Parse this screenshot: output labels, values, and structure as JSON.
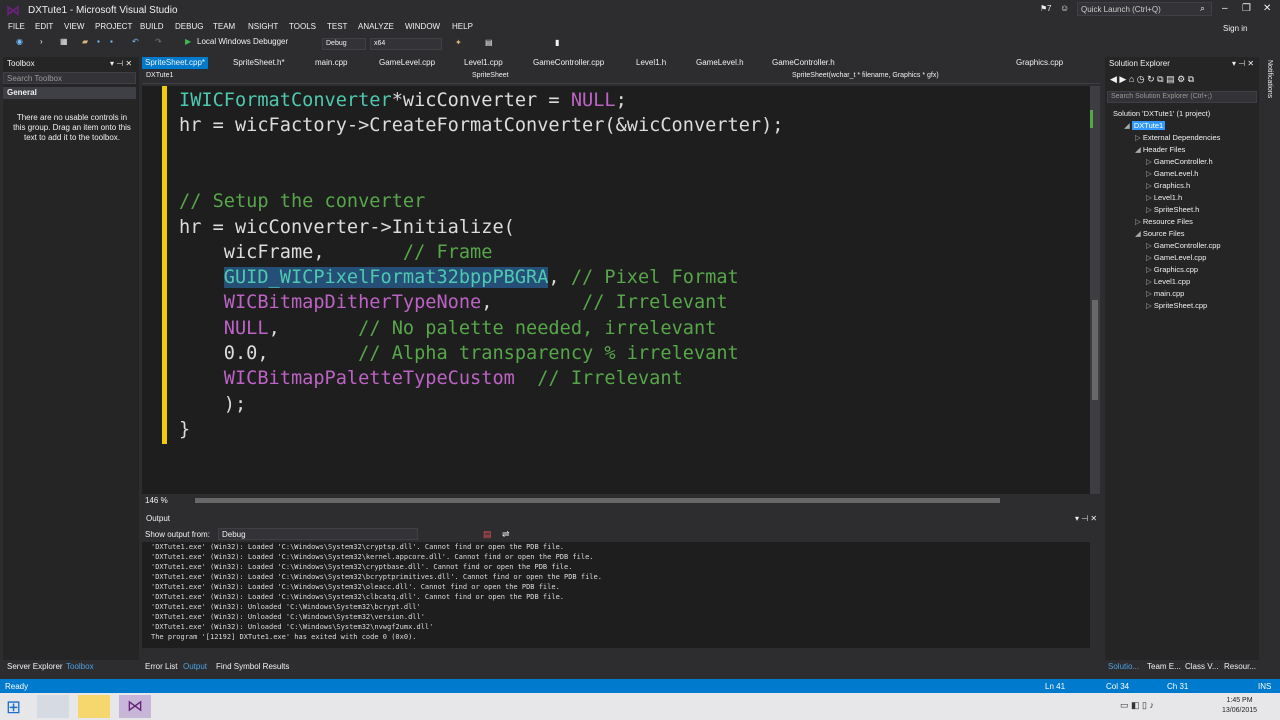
{
  "window": {
    "title": "DXTute1 - Microsoft Visual Studio"
  },
  "menu": [
    "FILE",
    "EDIT",
    "VIEW",
    "PROJECT",
    "BUILD",
    "DEBUG",
    "TEAM",
    "NSIGHT",
    "TOOLS",
    "TEST",
    "ANALYZE",
    "WINDOW",
    "HELP"
  ],
  "toolbar": {
    "debugger": "Local Windows Debugger",
    "config": "Debug",
    "platform": "x64",
    "quick_launch": "Quick Launch (Ctrl+Q)",
    "notifications": "7",
    "sign_in": "Sign in"
  },
  "toolbox": {
    "title": "Toolbox",
    "search": "Search Toolbox",
    "group": "General",
    "note": "There are no usable controls in this group. Drag an item onto this text to add it to the toolbox."
  },
  "tabs": [
    "SpriteSheet.cpp*",
    "SpriteSheet.h*",
    "main.cpp",
    "GameLevel.cpp",
    "Level1.cpp",
    "GameController.cpp",
    "Level1.h",
    "GameLevel.h",
    "GameController.h",
    "Graphics.cpp"
  ],
  "navbar": {
    "project": "DXTute1",
    "class": "SpriteSheet",
    "member": "SpriteSheet(wchar_t * filename, Graphics * gfx)"
  },
  "code": [
    [
      [
        "tp",
        "IWICFormatConverter"
      ],
      [
        "",
        "*wicConverter = "
      ],
      [
        "mac",
        "NULL"
      ],
      [
        "",
        ";"
      ]
    ],
    [
      [
        "",
        "hr = wicFactory->CreateFormatConverter(&wicConverter);"
      ]
    ],
    [
      [
        "",
        ""
      ]
    ],
    [
      [
        "",
        ""
      ]
    ],
    [
      [
        "cm",
        "// Setup the converter"
      ]
    ],
    [
      [
        "",
        "hr = wicConverter->Initialize("
      ]
    ],
    [
      [
        "",
        "    wicFrame,       "
      ],
      [
        "cm",
        "// Frame"
      ]
    ],
    [
      [
        "",
        "    "
      ],
      [
        "sel",
        "GUID_WICPixelFormat32bppPBGRA"
      ],
      [
        "",
        ", "
      ],
      [
        "cm",
        "// Pixel Format"
      ]
    ],
    [
      [
        "",
        "    "
      ],
      [
        "mac",
        "WICBitmapDitherTypeNone"
      ],
      [
        "",
        ",        "
      ],
      [
        "cm",
        "// Irrelevant"
      ]
    ],
    [
      [
        "",
        "    "
      ],
      [
        "mac",
        "NULL"
      ],
      [
        "",
        ",       "
      ],
      [
        "cm",
        "// No palette needed, irrelevant"
      ]
    ],
    [
      [
        "",
        "    0.0,        "
      ],
      [
        "cm",
        "// Alpha transparency % irrelevant"
      ]
    ],
    [
      [
        "",
        "    "
      ],
      [
        "mac",
        "WICBitmapPaletteTypeCustom"
      ],
      [
        "",
        "  "
      ],
      [
        "cm",
        "// Irrelevant"
      ]
    ],
    [
      [
        "",
        "    );"
      ]
    ],
    [
      [
        "",
        "}"
      ]
    ]
  ],
  "editor": {
    "zoom": "146 %"
  },
  "output": {
    "title": "Output",
    "source_label": "Show output from:",
    "source": "Debug",
    "lines": [
      "'DXTute1.exe' (Win32): Loaded 'C:\\Windows\\System32\\cryptsp.dll'. Cannot find or open the PDB file.",
      "'DXTute1.exe' (Win32): Loaded 'C:\\Windows\\System32\\kernel.appcore.dll'. Cannot find or open the PDB file.",
      "'DXTute1.exe' (Win32): Loaded 'C:\\Windows\\System32\\cryptbase.dll'. Cannot find or open the PDB file.",
      "'DXTute1.exe' (Win32): Loaded 'C:\\Windows\\System32\\bcryptprimitives.dll'. Cannot find or open the PDB file.",
      "'DXTute1.exe' (Win32): Loaded 'C:\\Windows\\System32\\oleacc.dll'. Cannot find or open the PDB file.",
      "'DXTute1.exe' (Win32): Loaded 'C:\\Windows\\System32\\clbcatq.dll'. Cannot find or open the PDB file.",
      "'DXTute1.exe' (Win32): Unloaded 'C:\\Windows\\System32\\bcrypt.dll'",
      "'DXTute1.exe' (Win32): Unloaded 'C:\\Windows\\System32\\version.dll'",
      "'DXTute1.exe' (Win32): Unloaded 'C:\\Windows\\System32\\nvwgf2umx.dll'",
      "The program '[12192] DXTute1.exe' has exited with code 0 (0x0)."
    ]
  },
  "bottom_tabs": [
    "Error List",
    "Output",
    "Find Symbol Results"
  ],
  "left_tabs": [
    "Server Explorer",
    "Toolbox"
  ],
  "solution": {
    "title": "Solution Explorer",
    "search": "Search Solution Explorer (Ctrl+;)",
    "tree": [
      {
        "label": "Solution 'DXTute1' (1 project)",
        "depth": 0
      },
      {
        "label": "DXTute1",
        "depth": 1,
        "selected": true
      },
      {
        "label": "External Dependencies",
        "depth": 2
      },
      {
        "label": "Header Files",
        "depth": 2
      },
      {
        "label": "GameController.h",
        "depth": 3
      },
      {
        "label": "GameLevel.h",
        "depth": 3
      },
      {
        "label": "Graphics.h",
        "depth": 3
      },
      {
        "label": "Level1.h",
        "depth": 3
      },
      {
        "label": "SpriteSheet.h",
        "depth": 3
      },
      {
        "label": "Resource Files",
        "depth": 2
      },
      {
        "label": "Source Files",
        "depth": 2
      },
      {
        "label": "GameController.cpp",
        "depth": 3
      },
      {
        "label": "GameLevel.cpp",
        "depth": 3
      },
      {
        "label": "Graphics.cpp",
        "depth": 3
      },
      {
        "label": "Level1.cpp",
        "depth": 3
      },
      {
        "label": "main.cpp",
        "depth": 3
      },
      {
        "label": "SpriteSheet.cpp",
        "depth": 3
      }
    ]
  },
  "side_tabs": [
    "Notifications"
  ],
  "se_bottom_tabs": [
    "Solutio...",
    "Team E...",
    "Class V...",
    "Resour..."
  ],
  "status": {
    "state": "Ready",
    "line": "Ln 41",
    "col": "Col 34",
    "ch": "Ch 31",
    "mode": "INS"
  },
  "clock": {
    "time": "1:45 PM",
    "date": "13/06/2015"
  }
}
